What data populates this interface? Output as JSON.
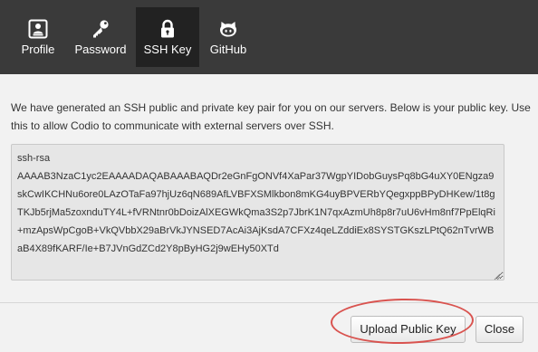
{
  "tabs": [
    {
      "label": "Profile",
      "icon": "profile-card-icon",
      "active": false
    },
    {
      "label": "Password",
      "icon": "key-icon",
      "active": false
    },
    {
      "label": "SSH Key",
      "icon": "lock-icon",
      "active": true
    },
    {
      "label": "GitHub",
      "icon": "github-icon",
      "active": false
    }
  ],
  "main": {
    "description": "We have generated an SSH public and private key pair for you on our servers. Below is your public key. Use this to allow Codio to communicate with external servers over SSH.",
    "public_key": "ssh-rsa\nAAAAB3NzaC1yc2EAAAADAQABAAABAQDr2eGnFgONVf4XaPar37WgpYIDobGuysPq8bG4uXY0ENgza9skCwIKCHNu6ore0LAzOTaFa97hjUz6qN689AfLVBFXSMlkbon8mKG4uyBPVERbYQegxppBPyDHKew/1t8gTKJb5rjMa5zoxnduTY4L+fVRNtnr0bDoizAlXEGWkQma3S2p7JbrK1N7qxAzmUh8p8r7uU6vHm8nf7PpElqRi+mzApsWpCgoB+VkQVbbX29aBrVkJYNSED7AcAi3AjKsdA7CFXz4qeLZddiEx8SYSTGKszLPtQ62nTvrWBaB4X89fKARF/Ie+B7JVnGdZCd2Y8pByHG2j9wEHy50XTd"
  },
  "footer": {
    "upload_label": "Upload Public Key",
    "close_label": "Close"
  },
  "colors": {
    "tabbar_bg": "#3a3a3a",
    "active_tab_bg": "#222222",
    "page_bg": "#f2f2f2",
    "key_box_bg": "#e6e6e6",
    "highlight": "#d9534f"
  }
}
